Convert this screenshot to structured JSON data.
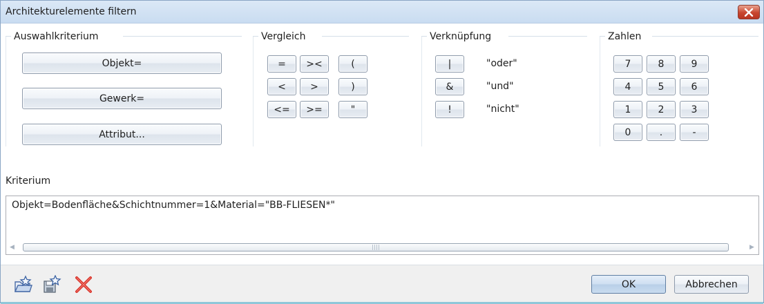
{
  "window": {
    "title": "Architekturelemente filtern"
  },
  "groups": {
    "auswahl": {
      "label": "Auswahlkriterium",
      "buttons": [
        "Objekt=",
        "Gewerk=",
        "Attribut..."
      ]
    },
    "vergleich": {
      "label": "Vergleich",
      "buttons": [
        "=",
        "><",
        "(",
        "<",
        ">",
        ")",
        "<=",
        ">=",
        "\""
      ]
    },
    "verknuepfung": {
      "label": "Verknüpfung",
      "items": [
        {
          "symbol": "|",
          "text": "\"oder\""
        },
        {
          "symbol": "&",
          "text": "\"und\""
        },
        {
          "symbol": "!",
          "text": "\"nicht\""
        }
      ]
    },
    "zahlen": {
      "label": "Zahlen",
      "buttons": [
        "7",
        "8",
        "9",
        "4",
        "5",
        "6",
        "1",
        "2",
        "3",
        "0",
        ".",
        "-"
      ]
    }
  },
  "kriterium": {
    "label": "Kriterium",
    "value": "Objekt=Bodenfläche&Schichtnummer=1&Material=\"BB-FLIESEN*\""
  },
  "footer": {
    "icons": [
      "open-favorite-icon",
      "save-favorite-icon",
      "delete-icon"
    ],
    "ok_label": "OK",
    "cancel_label": "Abbrechen"
  },
  "colors": {
    "titlebar": "#c9dcf1",
    "close": "#c8462f",
    "ok": "#b9cfe8",
    "footer": "#f0f0f0"
  }
}
